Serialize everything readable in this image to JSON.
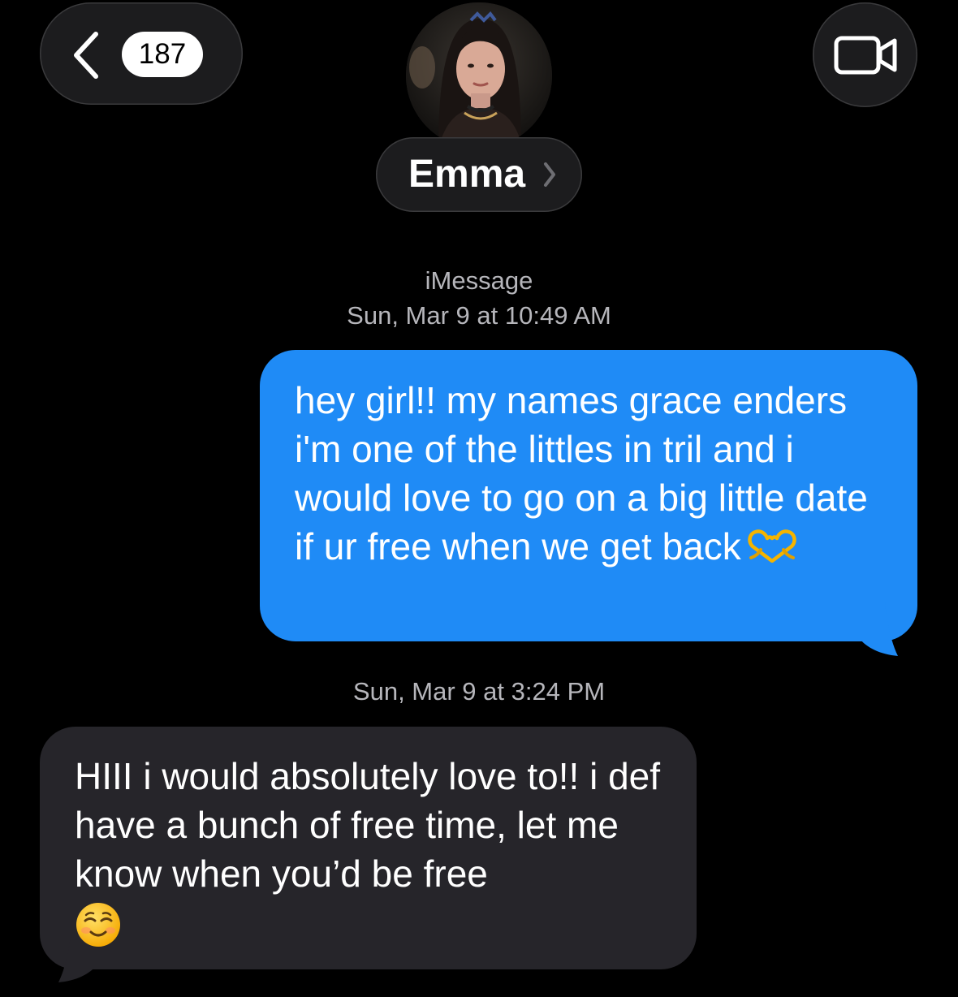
{
  "header": {
    "unread_count": "187",
    "back_icon": "chevron-left-icon",
    "video_icon": "video-camera-icon",
    "contact_name": "Emma",
    "contact_chevron": "chevron-right-icon"
  },
  "conversation": {
    "service_label": "iMessage",
    "timestamp_1": "Sun, Mar 9 at 10:49 AM",
    "outgoing_message": {
      "text": "hey girl!! my names grace enders i'm one of the littles in tril and i would love to go on a big little date if ur free when we get back",
      "emoji": "heart-hands-emoji"
    },
    "timestamp_2": "Sun, Mar 9 at 3:24 PM",
    "incoming_message": {
      "text": "HIII i would absolutely love to!! i def have a bunch of free time, let me know when you’d be free",
      "emoji": "smiling-face-emoji"
    }
  },
  "colors": {
    "background": "#000000",
    "outgoing_bubble": "#1f8bf6",
    "incoming_bubble": "#26252a",
    "meta_text": "#b6b6bb",
    "pill": "#1c1c1e"
  }
}
